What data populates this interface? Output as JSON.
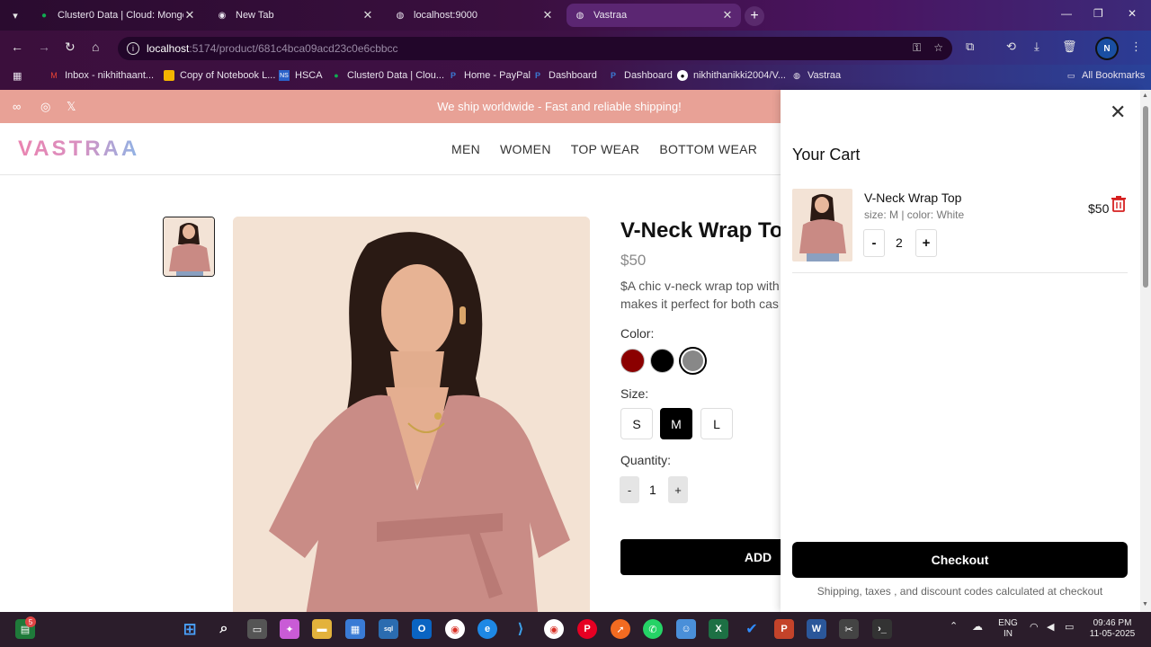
{
  "browser": {
    "tabs": [
      {
        "title": "Cluster0 Data | Cloud: MongoDB",
        "icon": "mongodb-leaf-icon",
        "active": false
      },
      {
        "title": "New Tab",
        "icon": "chrome-icon",
        "active": false
      },
      {
        "title": "localhost:9000",
        "icon": "globe-icon",
        "active": false
      },
      {
        "title": "Vastraa",
        "icon": "globe-icon",
        "active": true
      }
    ],
    "address": {
      "host": "localhost",
      "path": ":5174/product/681c4bca09acd23c0e6cbbcc"
    },
    "profile_initial": "N",
    "bookmarks": [
      {
        "label": "Inbox - nikhithaant...",
        "icon": "gmail-icon"
      },
      {
        "label": "Copy of Notebook L...",
        "icon": "slides-icon"
      },
      {
        "label": "HSCA",
        "icon": "ns-icon"
      },
      {
        "label": "Cluster0 Data | Clou...",
        "icon": "mongodb-leaf-icon"
      },
      {
        "label": "Home - PayPal",
        "icon": "paypal-icon"
      },
      {
        "label": "Dashboard",
        "icon": "paypal-icon"
      },
      {
        "label": "Dashboard",
        "icon": "paypal-icon"
      },
      {
        "label": "nikhithanikki2004/V...",
        "icon": "github-icon"
      },
      {
        "label": "Vastraa",
        "icon": "globe-icon"
      }
    ],
    "all_bookmarks": "All Bookmarks"
  },
  "site": {
    "promo": "We ship worldwide - Fast and reliable shipping!",
    "logo": "VASTRAA",
    "nav": [
      "MEN",
      "WOMEN",
      "TOP WEAR",
      "BOTTOM WEAR"
    ]
  },
  "product": {
    "title": "V-Neck Wrap Top",
    "price": "$50",
    "description": "$A chic v-neck wrap top with... makes it perfect for both cas...",
    "desc_line1": "$A chic v-neck wrap top with",
    "desc_line2": "makes it perfect for both cas",
    "color_label": "Color:",
    "colors": [
      "#8b0000",
      "#000000",
      "#888888"
    ],
    "size_label": "Size:",
    "sizes": [
      "S",
      "M",
      "L"
    ],
    "selected_size": "M",
    "quantity_label": "Quantity:",
    "quantity": "1",
    "minus": "-",
    "plus": "+",
    "add_button": "ADD"
  },
  "cart": {
    "title": "Your Cart",
    "items": [
      {
        "name": "V-Neck Wrap Top",
        "meta": "size: M | color: White",
        "price": "$50",
        "quantity": "2",
        "minus": "-",
        "plus": "+"
      }
    ],
    "checkout": "Checkout",
    "note": "Shipping, taxes , and discount codes calculated at checkout"
  },
  "taskbar": {
    "badge": "5",
    "lang": "ENG",
    "region": "IN",
    "time": "09:46 PM",
    "date": "11-05-2025"
  }
}
